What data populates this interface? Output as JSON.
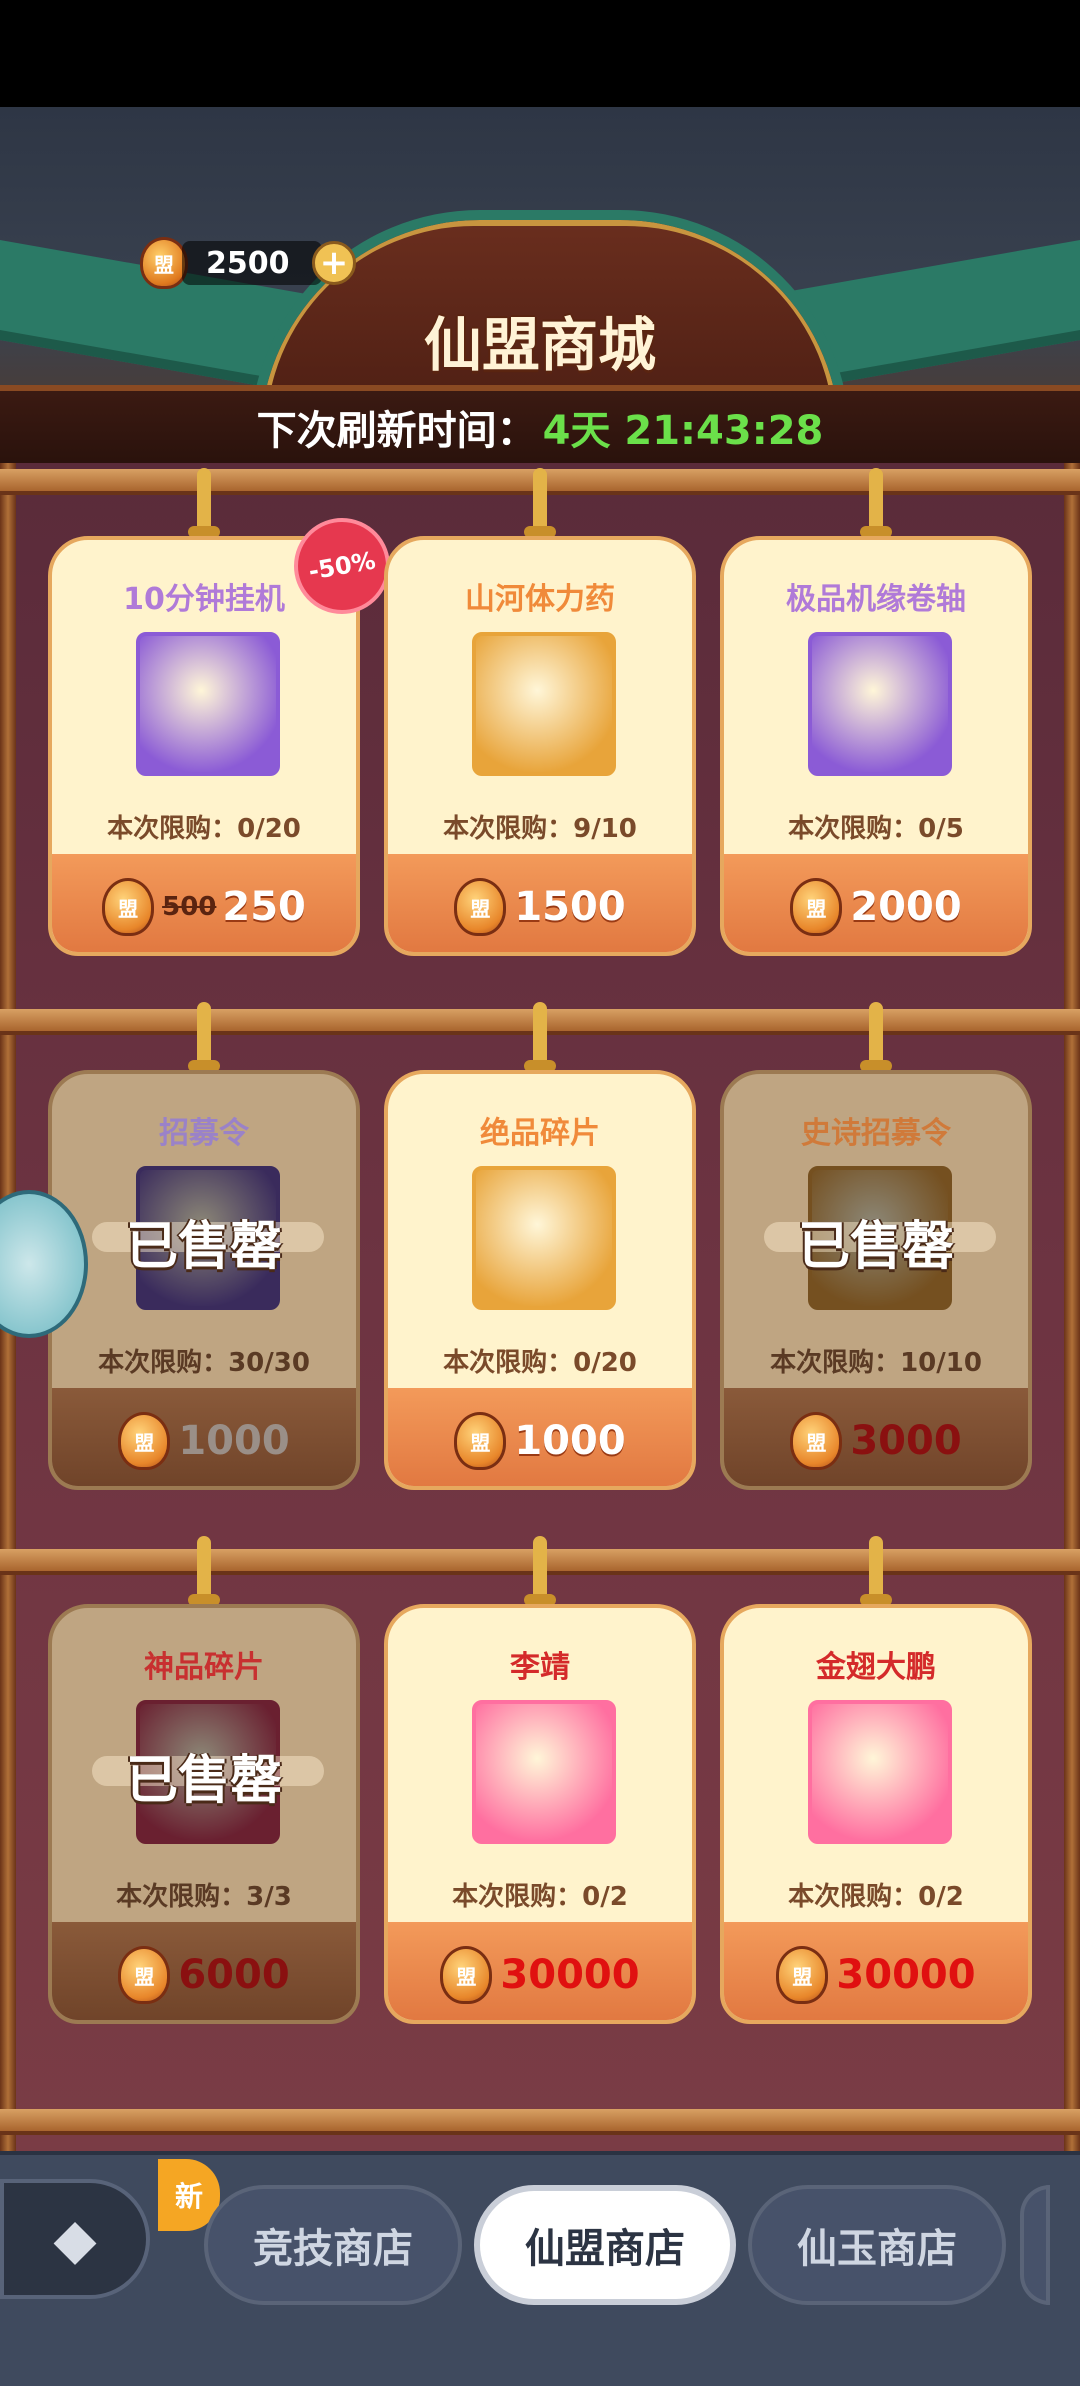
{
  "header": {
    "currency_icon": "盟",
    "currency_amount": "2500",
    "plus": "+",
    "title": "仙盟商城",
    "refresh_label": "下次刷新时间：",
    "refresh_value": "4天 21:43:28"
  },
  "discount_badge": "-50%",
  "sold_out_label": "已售罄",
  "items": [
    {
      "name": "10分钟挂机",
      "name_color": "#b07ad8",
      "limit": "本次限购：0/20",
      "old_price": "500",
      "price": "250",
      "icon": "hand-icon",
      "frame": "#8b5bd6"
    },
    {
      "name": "山河体力药",
      "name_color": "#f08a3a",
      "limit": "本次限购：9/10",
      "price": "1500",
      "icon": "potion-icon",
      "frame": "#e8a43a"
    },
    {
      "name": "极品机缘卷轴",
      "name_color": "#b07ad8",
      "limit": "本次限购：0/5",
      "price": "2000",
      "icon": "scroll-icon",
      "frame": "#8b5bd6"
    },
    {
      "name": "招募令",
      "name_color": "#9a82c8",
      "limit": "本次限购：30/30",
      "price": "1000",
      "icon": "token-icon",
      "frame": "#6a4fa8"
    },
    {
      "name": "绝品碎片",
      "name_color": "#f08a3a",
      "limit": "本次限购：0/20",
      "price": "1000",
      "icon": "fragment-icon",
      "frame": "#e8a43a"
    },
    {
      "name": "史诗招募令",
      "name_color": "#d07a3a",
      "limit": "本次限购：10/10",
      "price": "3000",
      "icon": "epic-token-icon",
      "frame": "#d4913a"
    },
    {
      "name": "神品碎片",
      "name_color": "#c83030",
      "limit": "本次限购：3/3",
      "price": "6000",
      "icon": "divine-fragment-icon",
      "frame": "#c03a58"
    },
    {
      "name": "李靖",
      "name_color": "#d42a2a",
      "limit": "本次限购：0/2",
      "price": "30000",
      "icon": "hero-li-jing-icon",
      "frame": "#ff6fa0"
    },
    {
      "name": "金翅大鹏",
      "name_color": "#d42a2a",
      "limit": "本次限购：0/2",
      "price": "30000",
      "icon": "hero-golden-roc-icon",
      "frame": "#ff6fa0"
    }
  ],
  "nav": {
    "new_badge": "新",
    "tabs": [
      "竞技商店",
      "仙盟商店",
      "仙玉商店"
    ],
    "active": "仙盟商店"
  }
}
